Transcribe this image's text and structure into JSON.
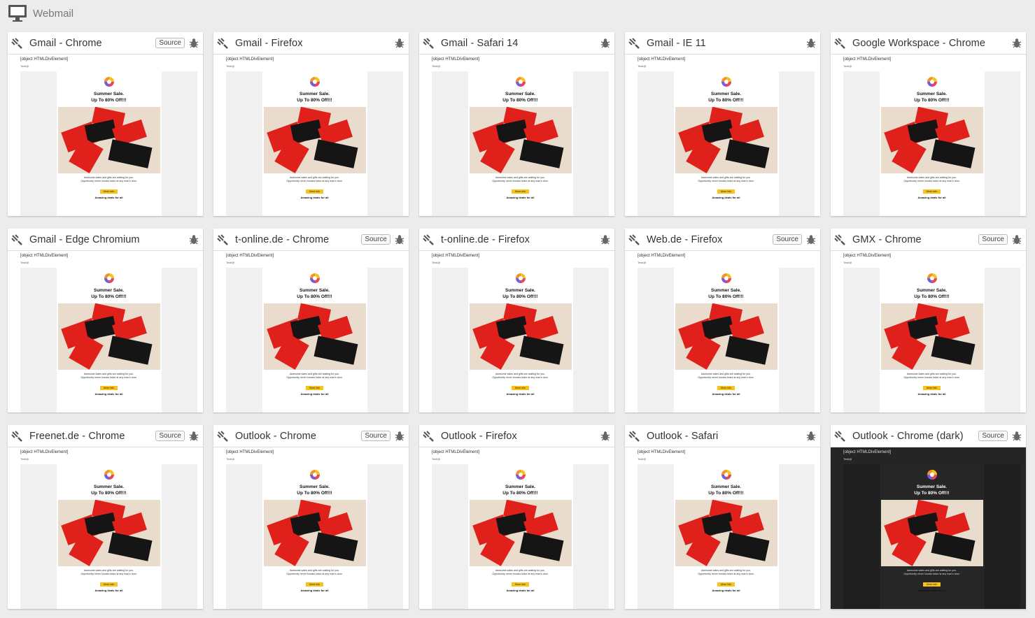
{
  "header": {
    "title": "Webmail",
    "icon": "monitor-icon"
  },
  "email": {
    "subject": "[object HTMLDivElement]",
    "sender": "Testi@",
    "title_line1": "Summer Sale.",
    "title_line2": "Up To 80% Off!!!",
    "body_line1": "Awesome sales and gifts are waiting for you.",
    "body_line2": "Opportunity never knocks twice at any man's door.",
    "button": "More info",
    "footer": "Amazing deals for all"
  },
  "cards": [
    {
      "title": "Gmail - Chrome",
      "source": "Source",
      "dark": false
    },
    {
      "title": "Gmail - Firefox",
      "source": "",
      "dark": false
    },
    {
      "title": "Gmail - Safari 14",
      "source": "",
      "dark": false
    },
    {
      "title": "Gmail - IE 11",
      "source": "",
      "dark": false
    },
    {
      "title": "Google Workspace - Chrome",
      "source": "",
      "dark": false
    },
    {
      "title": "Gmail - Edge Chromium",
      "source": "",
      "dark": false
    },
    {
      "title": "t-online.de - Chrome",
      "source": "Source",
      "dark": false
    },
    {
      "title": "t-online.de - Firefox",
      "source": "",
      "dark": false
    },
    {
      "title": "Web.de - Firefox",
      "source": "Source",
      "dark": false
    },
    {
      "title": "GMX - Chrome",
      "source": "Source",
      "dark": false
    },
    {
      "title": "Freenet.de - Chrome",
      "source": "Source",
      "dark": false
    },
    {
      "title": "Outlook - Chrome",
      "source": "Source",
      "dark": false
    },
    {
      "title": "Outlook - Firefox",
      "source": "",
      "dark": false
    },
    {
      "title": "Outlook - Safari",
      "source": "",
      "dark": false
    },
    {
      "title": "Outlook - Chrome (dark)",
      "source": "Source",
      "dark": true
    }
  ]
}
